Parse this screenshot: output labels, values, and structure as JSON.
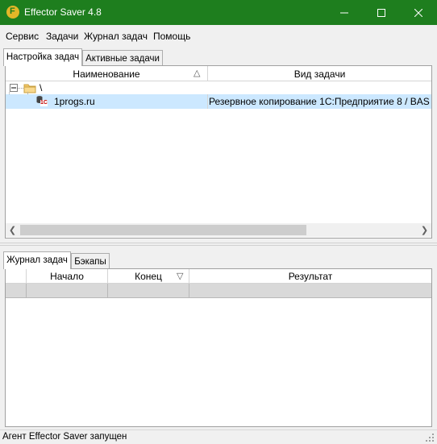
{
  "window": {
    "title": "Effector Saver 4.8",
    "minimize_glyph": "—",
    "maximize_glyph": "☐",
    "close_glyph": "✕",
    "app_icon_letter": "F"
  },
  "menu": [
    "Сервис",
    "Задачи",
    "Журнал задач",
    "Помощь"
  ],
  "top_tabs": [
    "Настройка задач",
    "Активные задачи"
  ],
  "task_tree": {
    "columns": [
      "Наименование",
      "Вид задачи"
    ],
    "sort_glyph": "△",
    "root_label": "\\",
    "row": {
      "name": "1progs.ru",
      "type": "Резервное копирование 1С:Предприятие 8 / BAS",
      "icon_text": "1C"
    }
  },
  "bottom_tabs": [
    "Журнал задач",
    "Бэкапы"
  ],
  "log_table": {
    "columns": [
      "Начало",
      "Конец",
      "Результат"
    ],
    "filter_glyph": "▽"
  },
  "status_text": "Агент Effector Saver запущен",
  "colors": {
    "titlebar": "#1e7e1e",
    "selection": "#cce8ff"
  }
}
